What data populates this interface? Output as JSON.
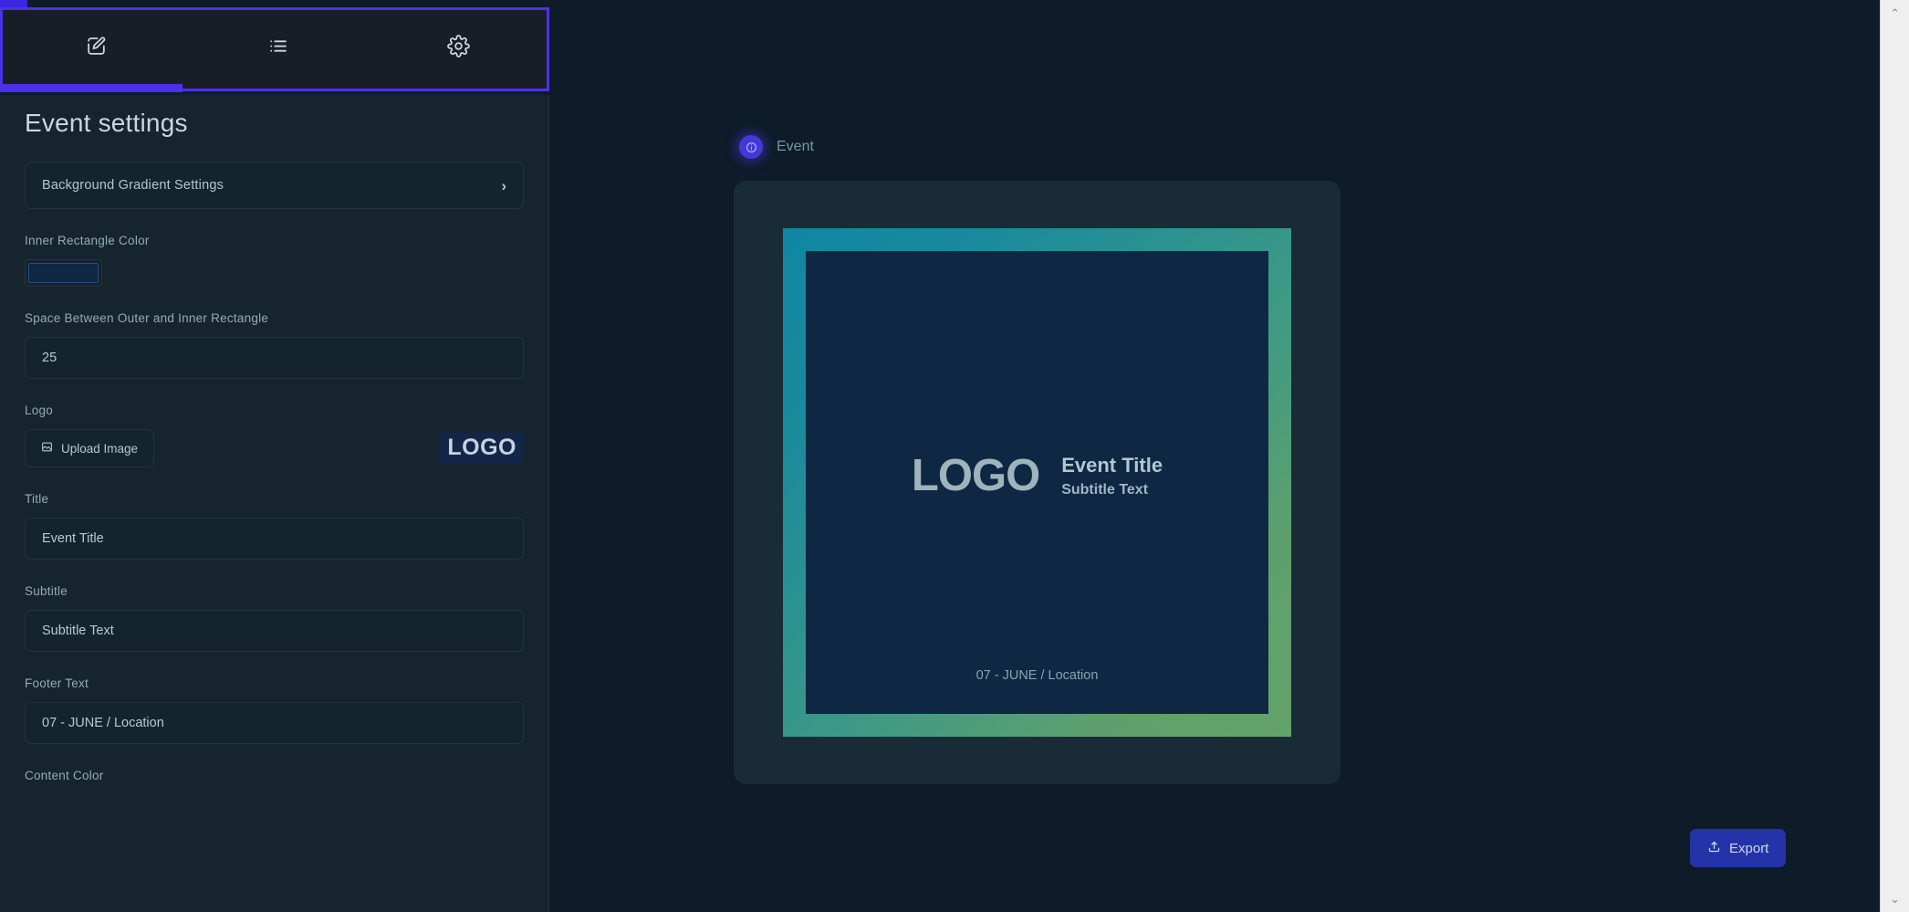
{
  "nav": {
    "tabs": [
      {
        "icon": "edit-square-icon",
        "name": "tab-edit",
        "active": true
      },
      {
        "icon": "list-icon",
        "name": "tab-list",
        "active": false
      },
      {
        "icon": "gear-icon",
        "name": "tab-settings",
        "active": false
      }
    ],
    "accent_color": "#4a32e8"
  },
  "settings": {
    "title": "Event settings",
    "accordion": {
      "label": "Background Gradient Settings",
      "chevron": "›"
    },
    "inner_rect_color": {
      "label": "Inner Rectangle Color",
      "value": "#0e2742"
    },
    "spacing": {
      "label": "Space Between Outer and Inner Rectangle",
      "value": "25",
      "placeholder": "25"
    },
    "logo": {
      "label": "Logo",
      "upload_label": "Upload Image",
      "thumb_text": "LOGO"
    },
    "title_field": {
      "label": "Title",
      "value": "Event Title",
      "placeholder": "Event Title"
    },
    "subtitle_field": {
      "label": "Subtitle",
      "value": "Subtitle Text",
      "placeholder": "Subtitle Text"
    },
    "footer_field": {
      "label": "Footer Text",
      "value": "07 - JUNE / Location",
      "placeholder": "07 - JUNE / Location"
    },
    "content_color": {
      "label": "Content Color"
    }
  },
  "preview": {
    "badge_label": "Event",
    "badge_icon": "info-circle-icon",
    "logo_text": "LOGO",
    "title": "Event Title",
    "subtitle": "Subtitle Text",
    "footer": "07 - JUNE / Location",
    "gradient_start": "#0f86a4",
    "gradient_end": "#63a26a",
    "inner_rect_color": "#0e2742",
    "card_bg": "#1a2b38"
  },
  "actions": {
    "export_label": "Export",
    "export_icon": "upload-icon"
  },
  "scrollbar": {
    "up_arrow": "⌃",
    "down_arrow": "⌄"
  }
}
